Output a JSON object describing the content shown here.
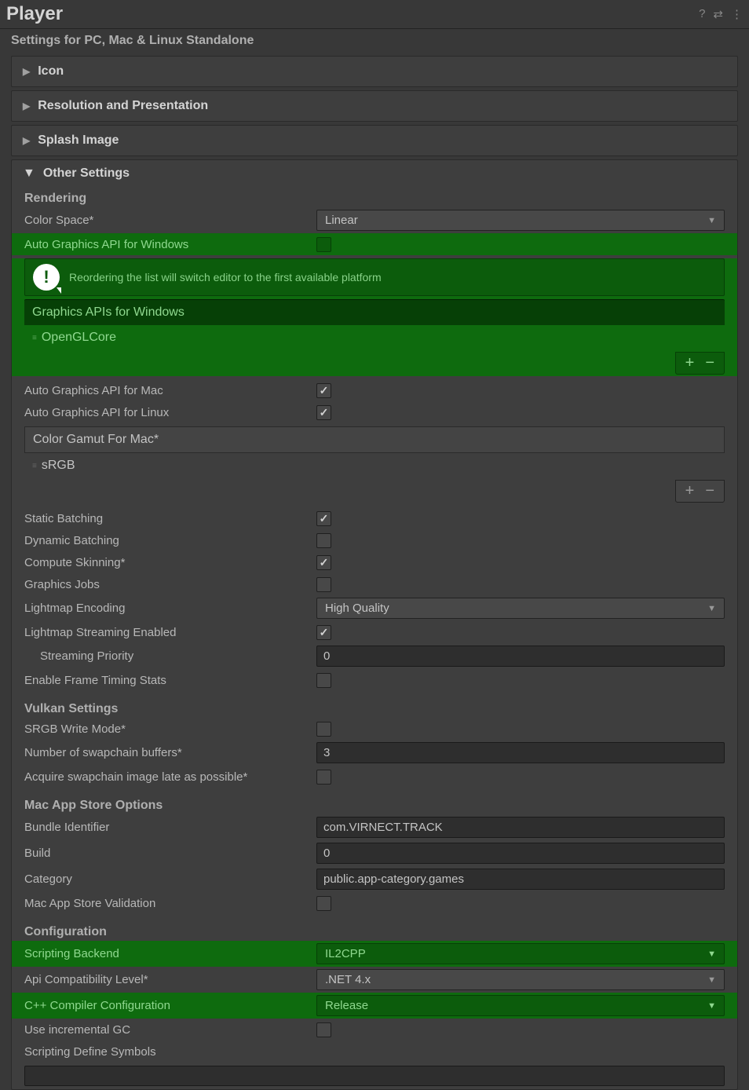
{
  "header": {
    "title": "Player"
  },
  "subtitle": "Settings for PC, Mac & Linux Standalone",
  "foldouts": {
    "icon": "Icon",
    "resolution": "Resolution and Presentation",
    "splash": "Splash Image",
    "other": "Other Settings"
  },
  "rendering": {
    "heading": "Rendering",
    "color_space_label": "Color Space*",
    "color_space_value": "Linear",
    "auto_gfx_win_label": "Auto Graphics API  for Windows",
    "info_msg": "Reordering the list will switch editor to the first available platform",
    "gfx_apis_win_header": "Graphics APIs for Windows",
    "gfx_apis_win_item": "OpenGLCore",
    "auto_gfx_mac_label": "Auto Graphics API  for Mac",
    "auto_gfx_linux_label": "Auto Graphics API  for Linux",
    "color_gamut_header": "Color Gamut For Mac*",
    "color_gamut_item": "sRGB",
    "static_batching": "Static Batching",
    "dynamic_batching": "Dynamic Batching",
    "compute_skinning": "Compute Skinning*",
    "graphics_jobs": "Graphics Jobs",
    "lightmap_encoding_label": "Lightmap Encoding",
    "lightmap_encoding_value": "High Quality",
    "lightmap_streaming": "Lightmap Streaming Enabled",
    "streaming_priority_label": "Streaming Priority",
    "streaming_priority_value": "0",
    "frame_timing": "Enable Frame Timing Stats"
  },
  "vulkan": {
    "heading": "Vulkan Settings",
    "srgb_write": "SRGB Write Mode*",
    "swapchain_label": "Number of swapchain buffers*",
    "swapchain_value": "3",
    "acquire_late": "Acquire swapchain image late as possible*"
  },
  "mac_store": {
    "heading": "Mac App Store Options",
    "bundle_label": "Bundle Identifier",
    "bundle_value": "com.VIRNECT.TRACK",
    "build_label": "Build",
    "build_value": "0",
    "category_label": "Category",
    "category_value": "public.app-category.games",
    "validation": "Mac App Store Validation"
  },
  "config": {
    "heading": "Configuration",
    "backend_label": "Scripting Backend",
    "backend_value": "IL2CPP",
    "api_compat_label": "Api Compatibility Level*",
    "api_compat_value": ".NET 4.x",
    "cpp_config_label": "C++ Compiler Configuration",
    "cpp_config_value": "Release",
    "incremental_gc": "Use incremental GC",
    "define_symbols": "Scripting Define Symbols"
  }
}
